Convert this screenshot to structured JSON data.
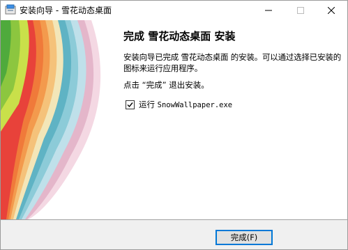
{
  "window": {
    "title": "安装向导 - 雪花动态桌面",
    "minimize_label": "—",
    "maximize_label": "☐",
    "close_label": "✕"
  },
  "content": {
    "heading": "完成 雪花动态桌面 安装",
    "description": "安装向导已完成 雪花动态桌面 的安装。可以通过选择已安装的图标来运行应用程序。",
    "hint": "点击 “完成” 退出安装。",
    "run_prefix": "运行 ",
    "run_exe": "SnowWallpaper.exe",
    "run_checked": true
  },
  "footer": {
    "finish_label": "完成(F)"
  },
  "colors": {
    "accent": "#0078d7",
    "footer_bg": "#f0f0f0"
  },
  "icons": [
    "installer-app-icon",
    "minimize-icon",
    "maximize-icon",
    "close-icon",
    "checkmark-icon"
  ]
}
